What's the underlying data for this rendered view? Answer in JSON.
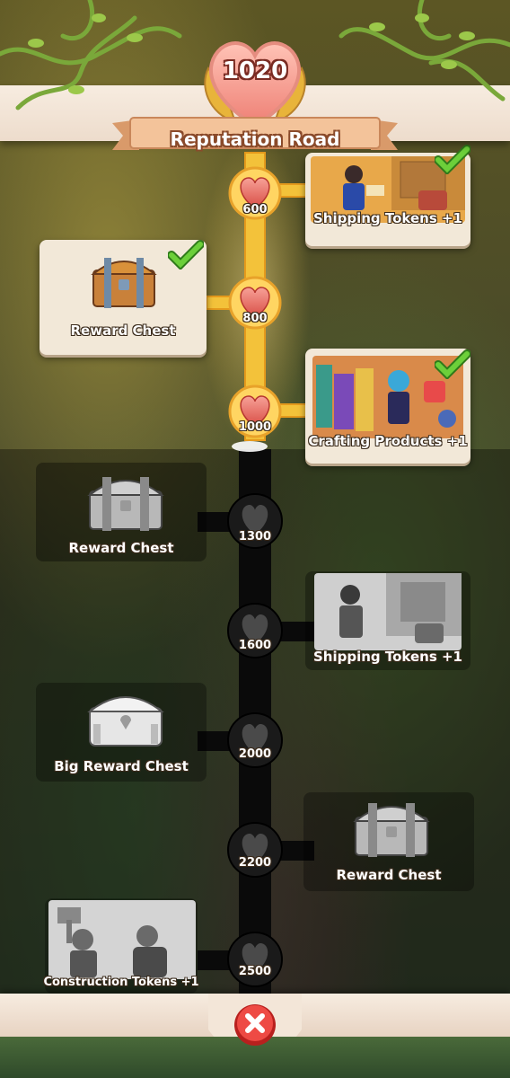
{
  "header": {
    "reputation_value": "1020",
    "title": "Reputation Road"
  },
  "road": {
    "milestones": [
      {
        "value": "600",
        "unlocked": true
      },
      {
        "value": "800",
        "unlocked": true
      },
      {
        "value": "1000",
        "unlocked": true
      },
      {
        "value": "1300",
        "unlocked": false
      },
      {
        "value": "1600",
        "unlocked": false
      },
      {
        "value": "2000",
        "unlocked": false
      },
      {
        "value": "2200",
        "unlocked": false
      },
      {
        "value": "2500",
        "unlocked": false
      }
    ],
    "rewards": [
      {
        "label": "Shipping Tokens +1",
        "icon": "shipping-tokens-picture",
        "claimed": true
      },
      {
        "label": "Reward Chest",
        "icon": "chest-icon",
        "claimed": true
      },
      {
        "label": "Crafting Products +1",
        "icon": "crafting-products-picture",
        "claimed": true
      },
      {
        "label": "Reward Chest",
        "icon": "chest-icon",
        "claimed": false
      },
      {
        "label": "Shipping Tokens +1",
        "icon": "shipping-tokens-picture",
        "claimed": false
      },
      {
        "label": "Big Reward Chest",
        "icon": "big-chest-icon",
        "claimed": false
      },
      {
        "label": "Reward Chest",
        "icon": "chest-icon",
        "claimed": false
      },
      {
        "label": "Construction Tokens +1",
        "icon": "construction-tokens-picture",
        "claimed": false
      }
    ]
  },
  "footer": {
    "close_icon": "close-x-icon"
  },
  "colors": {
    "road_active": "#f3c23a",
    "road_locked": "#0a0a0a",
    "heart_red": "#e0564b",
    "check_green": "#5cc23a",
    "card_bg": "#f2e8d8",
    "close_red": "#e0383a"
  }
}
